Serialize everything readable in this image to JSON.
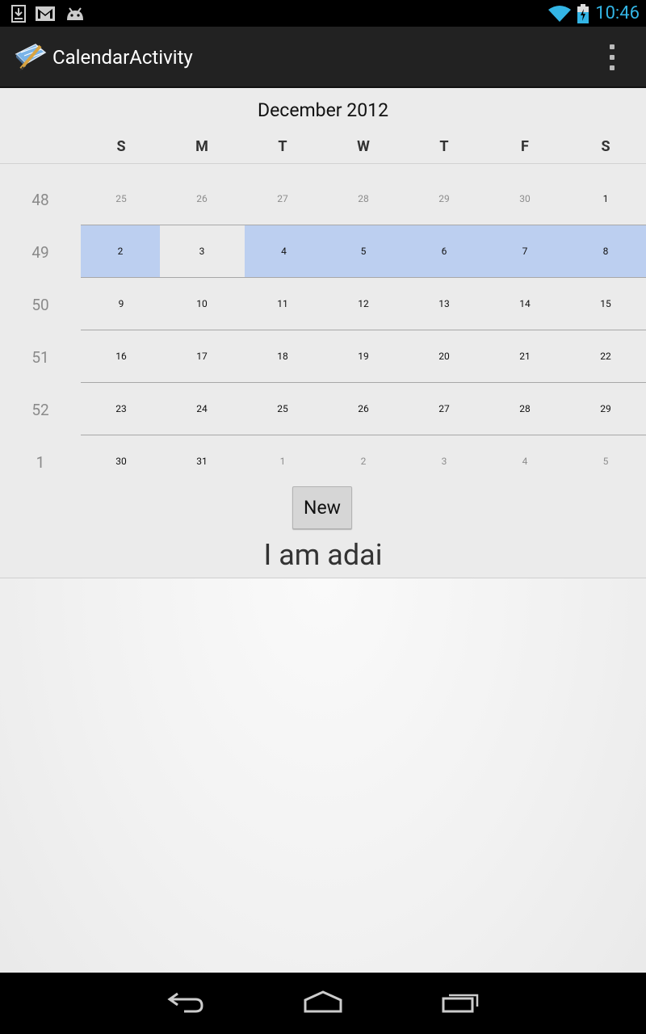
{
  "status_bar": {
    "time": "10:46",
    "icons": [
      "download-icon",
      "gmail-icon",
      "android-icon",
      "wifi-icon",
      "battery-charging-icon"
    ],
    "accent_color": "#33b5e5"
  },
  "action_bar": {
    "title": "CalendarActivity",
    "app_icon": "calendar-app-icon",
    "overflow_icon": "overflow-menu-icon"
  },
  "calendar": {
    "month_label": "December 2012",
    "day_headers": [
      "S",
      "M",
      "T",
      "W",
      "T",
      "F",
      "S"
    ],
    "selection_color": "#bccff0",
    "weeks": [
      {
        "week_number": "48",
        "days": [
          {
            "label": "25",
            "in_month": false
          },
          {
            "label": "26",
            "in_month": false
          },
          {
            "label": "27",
            "in_month": false
          },
          {
            "label": "28",
            "in_month": false
          },
          {
            "label": "29",
            "in_month": false
          },
          {
            "label": "30",
            "in_month": false
          },
          {
            "label": "1",
            "in_month": true
          }
        ]
      },
      {
        "week_number": "49",
        "days": [
          {
            "label": "2",
            "in_month": true,
            "selected": true
          },
          {
            "label": "3",
            "in_month": true
          },
          {
            "label": "4",
            "in_month": true,
            "selected": true
          },
          {
            "label": "5",
            "in_month": true,
            "selected": true
          },
          {
            "label": "6",
            "in_month": true,
            "selected": true
          },
          {
            "label": "7",
            "in_month": true,
            "selected": true
          },
          {
            "label": "8",
            "in_month": true,
            "selected": true
          }
        ]
      },
      {
        "week_number": "50",
        "days": [
          {
            "label": "9",
            "in_month": true
          },
          {
            "label": "10",
            "in_month": true
          },
          {
            "label": "11",
            "in_month": true
          },
          {
            "label": "12",
            "in_month": true
          },
          {
            "label": "13",
            "in_month": true
          },
          {
            "label": "14",
            "in_month": true
          },
          {
            "label": "15",
            "in_month": true
          }
        ]
      },
      {
        "week_number": "51",
        "days": [
          {
            "label": "16",
            "in_month": true
          },
          {
            "label": "17",
            "in_month": true
          },
          {
            "label": "18",
            "in_month": true
          },
          {
            "label": "19",
            "in_month": true
          },
          {
            "label": "20",
            "in_month": true
          },
          {
            "label": "21",
            "in_month": true
          },
          {
            "label": "22",
            "in_month": true
          }
        ]
      },
      {
        "week_number": "52",
        "days": [
          {
            "label": "23",
            "in_month": true
          },
          {
            "label": "24",
            "in_month": true
          },
          {
            "label": "25",
            "in_month": true
          },
          {
            "label": "26",
            "in_month": true
          },
          {
            "label": "27",
            "in_month": true
          },
          {
            "label": "28",
            "in_month": true
          },
          {
            "label": "29",
            "in_month": true
          }
        ]
      },
      {
        "week_number": "1",
        "days": [
          {
            "label": "30",
            "in_month": true
          },
          {
            "label": "31",
            "in_month": true
          },
          {
            "label": "1",
            "in_month": false
          },
          {
            "label": "2",
            "in_month": false
          },
          {
            "label": "3",
            "in_month": false
          },
          {
            "label": "4",
            "in_month": false
          },
          {
            "label": "5",
            "in_month": false
          }
        ]
      }
    ]
  },
  "main": {
    "new_button_label": "New",
    "text_label": "I am adai"
  },
  "nav_bar": {
    "icons": [
      "back-icon",
      "home-icon",
      "recent-apps-icon"
    ]
  }
}
